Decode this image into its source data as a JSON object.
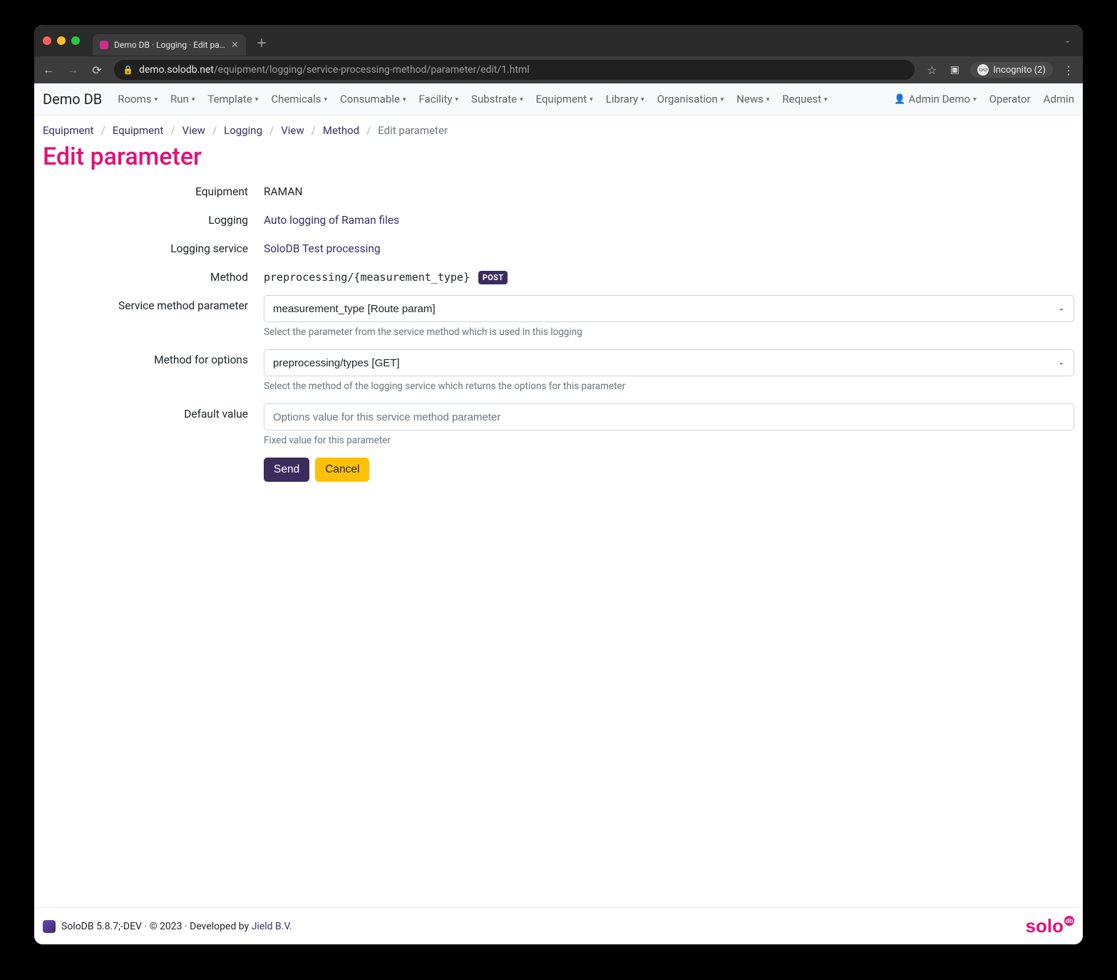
{
  "browser": {
    "tab_title": "Demo DB · Logging · Edit param",
    "url_host": "demo.solodb.net",
    "url_path": "/equipment/logging/service-processing-method/parameter/edit/1.html",
    "incognito_label": "Incognito (2)"
  },
  "nav": {
    "brand": "Demo DB",
    "items_left": [
      "Rooms",
      "Run",
      "Template",
      "Chemicals",
      "Consumable",
      "Facility",
      "Substrate",
      "Equipment",
      "Library",
      "Organisation",
      "News",
      "Request"
    ],
    "admin_demo": "Admin Demo",
    "operator": "Operator",
    "admin": "Admin"
  },
  "breadcrumbs": [
    "Equipment",
    "Equipment",
    "View",
    "Logging",
    "View",
    "Method",
    "Edit parameter"
  ],
  "page_title": "Edit parameter",
  "form": {
    "labels": {
      "equipment": "Equipment",
      "logging": "Logging",
      "logging_service": "Logging service",
      "method": "Method",
      "smp": "Service method parameter",
      "mfo": "Method for options",
      "default": "Default value"
    },
    "equipment_value": "RAMAN",
    "logging_value": "Auto logging of Raman files",
    "logging_service_value": "SoloDB Test processing",
    "method_path": "preprocessing/{measurement_type}",
    "method_badge": "POST",
    "smp_value": "measurement_type [Route param]",
    "smp_help": "Select the parameter from the service method which is used in this logging",
    "mfo_value": "preprocessing/types [GET]",
    "mfo_help": "Select the method of the logging service which returns the options for this parameter",
    "default_placeholder": "Options value for this service method parameter",
    "default_help": "Fixed value for this parameter"
  },
  "buttons": {
    "send": "Send",
    "cancel": "Cancel"
  },
  "footer": {
    "version": "SoloDB 5.8.7;-DEV",
    "year": "© 2023",
    "developed_by": "Developed by",
    "company": "Jield B.V.",
    "brand_text": "solo",
    "brand_sup": "db"
  }
}
